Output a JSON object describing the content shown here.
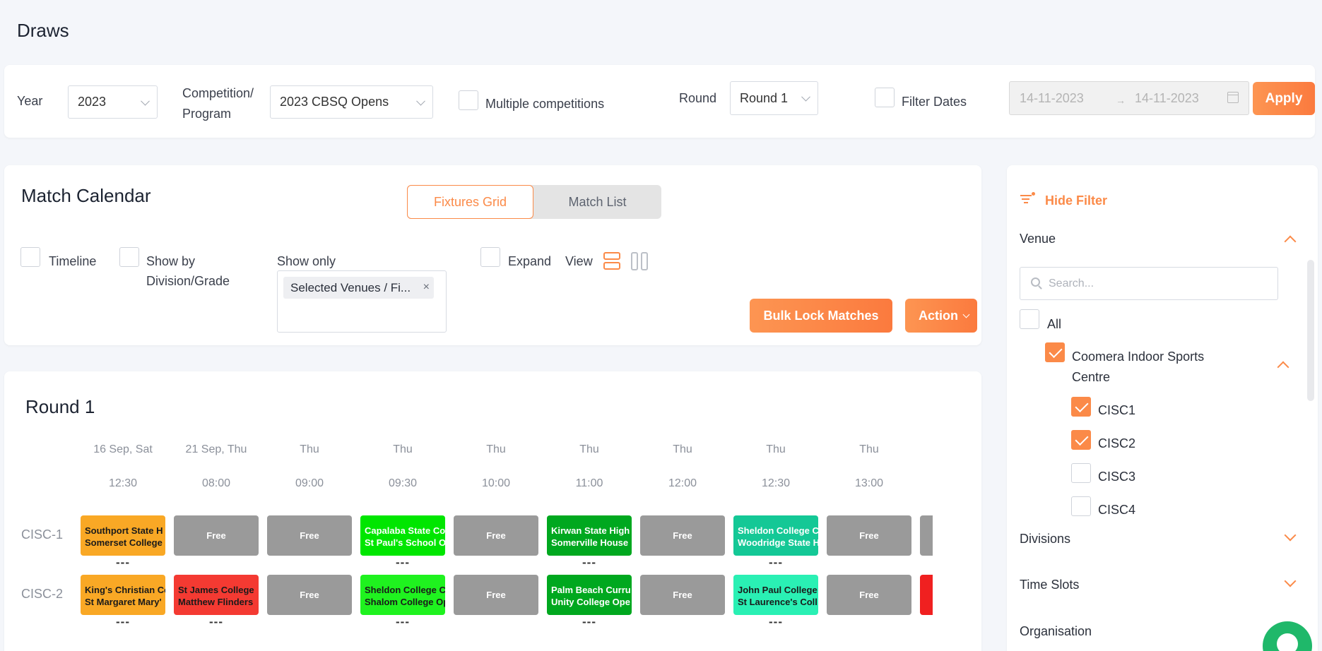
{
  "page_title": "Draws",
  "filters": {
    "year_label": "Year",
    "year_value": "2023",
    "competition_label_line1": "Competition/",
    "competition_label_line2": "Program",
    "competition_value": "2023 CBSQ Opens",
    "multiple_competitions_label": "Multiple competitions",
    "round_label": "Round",
    "round_value": "Round 1",
    "filter_dates_label": "Filter Dates",
    "date_from": "14-11-2023",
    "date_to": "14-11-2023",
    "apply_label": "Apply"
  },
  "calendar": {
    "title": "Match Calendar",
    "tab_fixtures": "Fixtures Grid",
    "tab_list": "Match List",
    "timeline_label": "Timeline",
    "show_by_line1": "Show by",
    "show_by_line2": "Division/Grade",
    "show_only_label": "Show only",
    "show_only_chip": "Selected Venues / Fi...",
    "expand_label": "Expand",
    "view_label": "View",
    "bulk_lock_label": "Bulk Lock Matches",
    "action_label": "Action"
  },
  "round": {
    "title": "Round 1",
    "columns": [
      {
        "day": "16 Sep, Sat",
        "time": "12:30"
      },
      {
        "day": "21 Sep, Thu",
        "time": "08:00"
      },
      {
        "day": "Thu",
        "time": "09:00"
      },
      {
        "day": "Thu",
        "time": "09:30"
      },
      {
        "day": "Thu",
        "time": "10:00"
      },
      {
        "day": "Thu",
        "time": "11:00"
      },
      {
        "day": "Thu",
        "time": "12:00"
      },
      {
        "day": "Thu",
        "time": "12:30"
      },
      {
        "day": "Thu",
        "time": "13:00"
      }
    ],
    "rows": [
      {
        "label": "CISC-1",
        "cells": [
          {
            "kind": "match",
            "line1": "Southport State H",
            "line2": "Somerset College",
            "bg": "#f9a825",
            "fg": "#1a1a1a",
            "dots": "---"
          },
          {
            "kind": "free",
            "text": "Free"
          },
          {
            "kind": "free",
            "text": "Free"
          },
          {
            "kind": "match",
            "line1": "Capalaba State Co",
            "line2": "St Paul's School O",
            "bg": "#00e600",
            "fg": "#ffffff",
            "dots": "---"
          },
          {
            "kind": "free",
            "text": "Free"
          },
          {
            "kind": "match",
            "line1": "Kirwan State High",
            "line2": "Somerville House",
            "bg": "#00a81f",
            "fg": "#ffffff",
            "dots": "---"
          },
          {
            "kind": "free",
            "text": "Free"
          },
          {
            "kind": "match",
            "line1": "Sheldon College C",
            "line2": "Woodridge State H",
            "bg": "#14c896",
            "fg": "#ffffff",
            "dots": "---"
          },
          {
            "kind": "free",
            "text": "Free"
          },
          {
            "kind": "free",
            "text": ""
          }
        ]
      },
      {
        "label": "CISC-2",
        "cells": [
          {
            "kind": "match",
            "line1": "King's Christian Co",
            "line2": "St Margaret Mary'",
            "bg": "#f9a825",
            "fg": "#1a1a1a",
            "dots": "---"
          },
          {
            "kind": "match",
            "line1": "St James College",
            "line2": "Matthew Flinders",
            "bg": "#f43a32",
            "fg": "#1a1a1a",
            "dots": "---"
          },
          {
            "kind": "free",
            "text": "Free"
          },
          {
            "kind": "match",
            "line1": "Sheldon College C",
            "line2": "Shalom College Op",
            "bg": "#1ff21f",
            "fg": "#1a1a1a",
            "dots": "---"
          },
          {
            "kind": "free",
            "text": "Free"
          },
          {
            "kind": "match",
            "line1": "Palm Beach Curru",
            "line2": "Unity College Ope",
            "bg": "#00a81f",
            "fg": "#ffffff",
            "dots": "---"
          },
          {
            "kind": "free",
            "text": "Free"
          },
          {
            "kind": "match",
            "line1": "John Paul College",
            "line2": "St Laurence's Coll",
            "bg": "#2af0b4",
            "fg": "#1a1a1a",
            "dots": "---"
          },
          {
            "kind": "free",
            "text": "Free"
          },
          {
            "kind": "match",
            "line1": "",
            "line2": "",
            "bg": "#f02020",
            "fg": "#1a1a1a",
            "dots": ""
          }
        ]
      }
    ]
  },
  "side_panel": {
    "hide_filter_label": "Hide Filter",
    "venue_title": "Venue",
    "search_placeholder": "Search...",
    "all_label": "All",
    "venue_group_line1": "Coomera Indoor Sports",
    "venue_group_line2": "Centre",
    "courts": [
      {
        "label": "CISC1",
        "checked": true
      },
      {
        "label": "CISC2",
        "checked": true
      },
      {
        "label": "CISC3",
        "checked": false
      },
      {
        "label": "CISC4",
        "checked": false
      }
    ],
    "divisions_title": "Divisions",
    "time_slots_title": "Time Slots",
    "organisation_title": "Organisation"
  },
  "colors": {
    "accent": "#fb8a48",
    "free_cell": "#9a9a9a"
  }
}
